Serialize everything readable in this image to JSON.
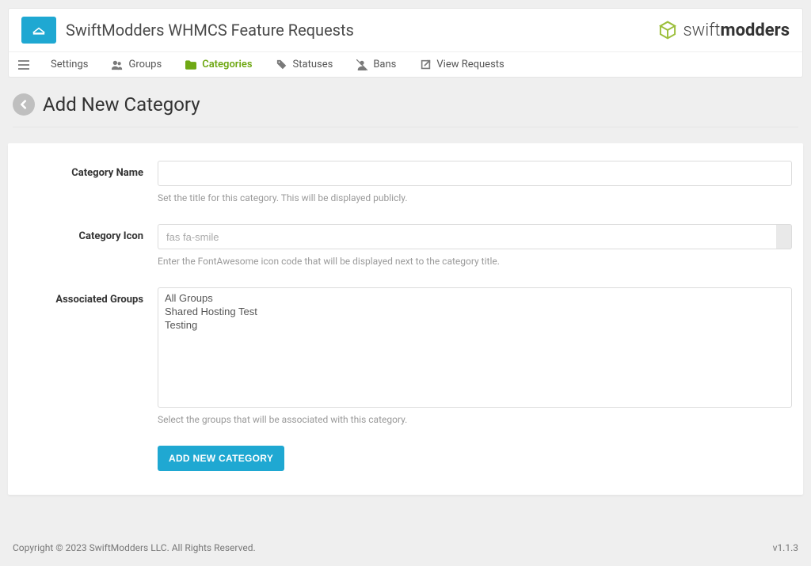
{
  "header": {
    "app_title": "SwiftModders WHMCS Feature Requests",
    "brand_prefix": "swift",
    "brand_suffix": "modders"
  },
  "nav": {
    "items": [
      {
        "label": "Settings",
        "icon": "menu",
        "active": false
      },
      {
        "label": "Groups",
        "icon": "users",
        "active": false
      },
      {
        "label": "Categories",
        "icon": "folder",
        "active": true
      },
      {
        "label": "Statuses",
        "icon": "tags",
        "active": false
      },
      {
        "label": "Bans",
        "icon": "user-slash",
        "active": false
      },
      {
        "label": "View Requests",
        "icon": "external",
        "active": false
      }
    ]
  },
  "page": {
    "title": "Add New Category"
  },
  "form": {
    "category_name": {
      "label": "Category Name",
      "value": "",
      "help": "Set the title for this category. This will be displayed publicly."
    },
    "category_icon": {
      "label": "Category Icon",
      "value": "",
      "placeholder": "fas fa-smile",
      "help": "Enter the FontAwesome icon code that will be displayed next to the category title."
    },
    "associated_groups": {
      "label": "Associated Groups",
      "options": [
        "All Groups",
        "Shared Hosting Test",
        "Testing"
      ],
      "help": "Select the groups that will be associated with this category."
    },
    "submit_label": "ADD NEW CATEGORY"
  },
  "footer": {
    "copyright": "Copyright © 2023 SwiftModders LLC. All Rights Reserved.",
    "version": "v1.1.3"
  }
}
